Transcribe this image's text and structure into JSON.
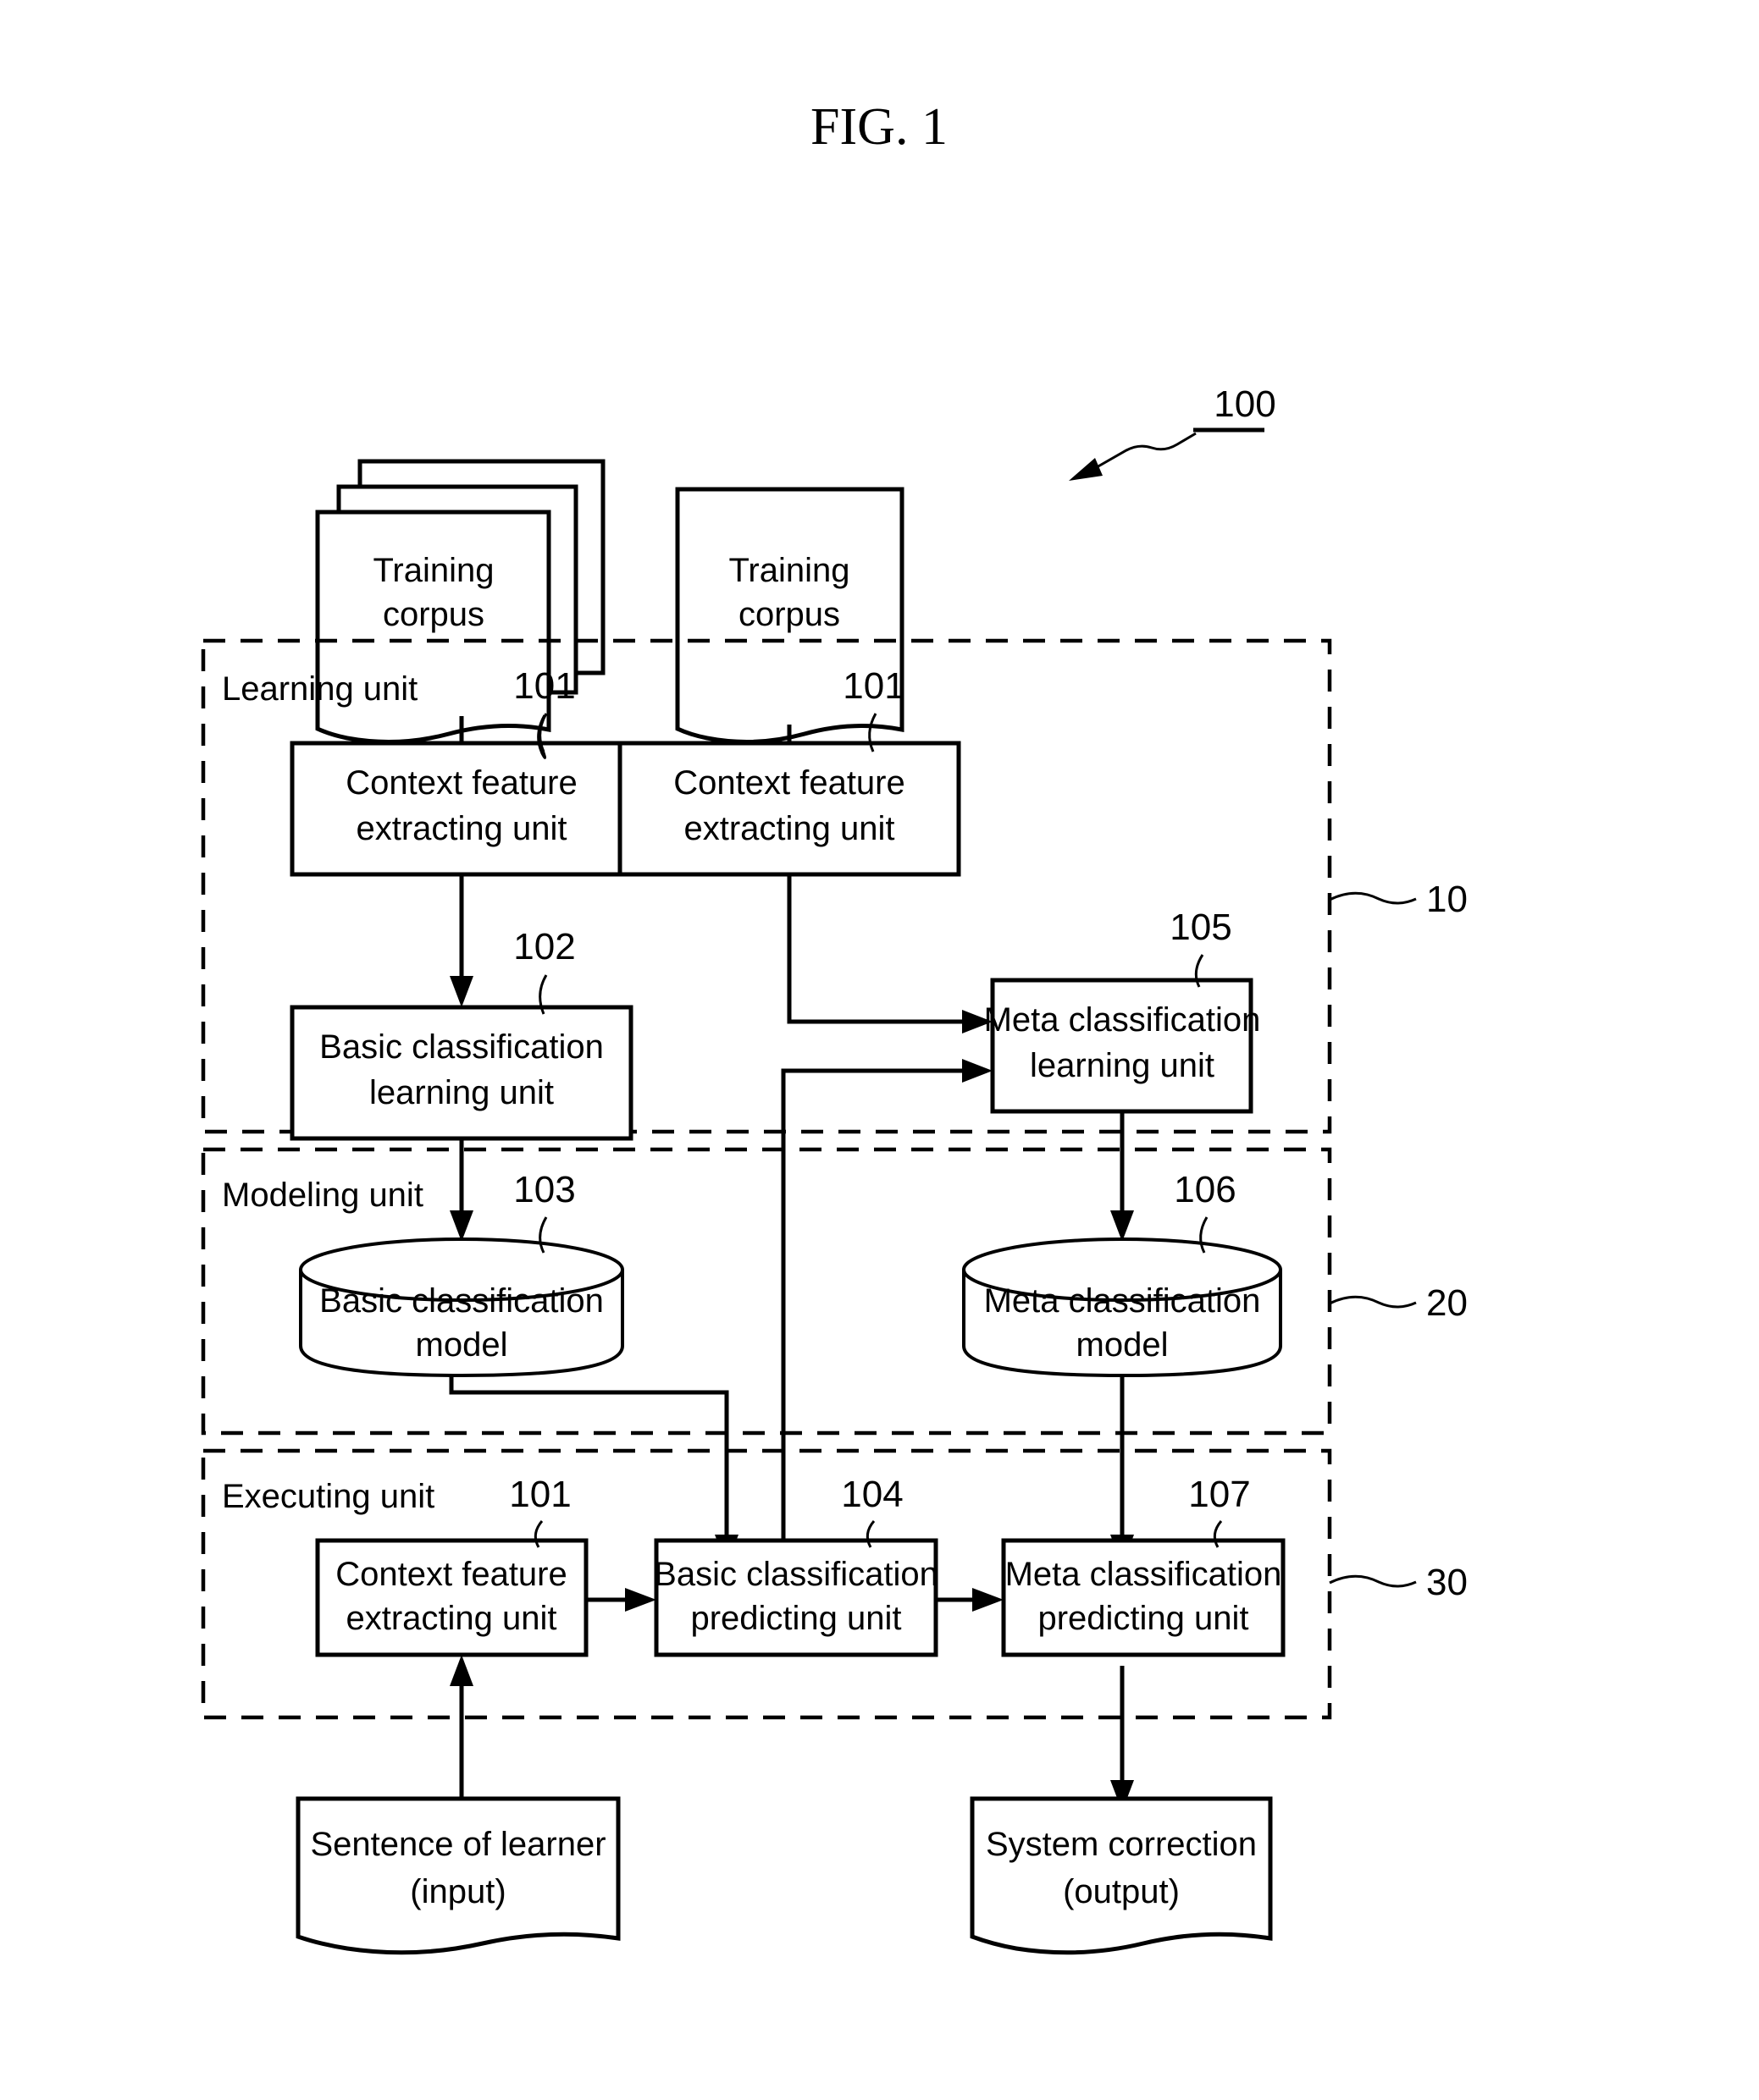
{
  "figure": {
    "title": "FIG. 1",
    "system_ref": "100"
  },
  "sources": [
    {
      "id": "training-corpus-left",
      "lines": [
        "Training",
        "corpus"
      ],
      "shape": "document-stack"
    },
    {
      "id": "training-corpus-right",
      "lines": [
        "Training",
        "corpus"
      ],
      "shape": "document"
    }
  ],
  "groups": [
    {
      "id": "learning-unit",
      "label": "Learning unit",
      "ref": "10"
    },
    {
      "id": "modeling-unit",
      "label": "Modeling unit",
      "ref": "20"
    },
    {
      "id": "executing-unit",
      "label": "Executing unit",
      "ref": "30"
    }
  ],
  "blocks": [
    {
      "id": "context-feature-extracting-unit-learning-left",
      "ref": "101",
      "lines": [
        "Context feature",
        "extracting unit"
      ],
      "group": "learning-unit"
    },
    {
      "id": "context-feature-extracting-unit-learning-right",
      "ref": "101",
      "lines": [
        "Context feature",
        "extracting unit"
      ],
      "group": "learning-unit"
    },
    {
      "id": "basic-classification-learning-unit",
      "ref": "102",
      "lines": [
        "Basic classification",
        "learning unit"
      ],
      "group": "learning-unit"
    },
    {
      "id": "meta-classification-learning-unit",
      "ref": "105",
      "lines": [
        "Meta classification",
        "learning unit"
      ],
      "group": "learning-unit"
    },
    {
      "id": "basic-classification-model",
      "ref": "103",
      "lines": [
        "Basic classification",
        "model"
      ],
      "group": "modeling-unit",
      "shape": "cylinder"
    },
    {
      "id": "meta-classification-model",
      "ref": "106",
      "lines": [
        "Meta classification",
        "model"
      ],
      "group": "modeling-unit",
      "shape": "cylinder"
    },
    {
      "id": "context-feature-extracting-unit-executing",
      "ref": "101",
      "lines": [
        "Context feature",
        "extracting unit"
      ],
      "group": "executing-unit"
    },
    {
      "id": "basic-classification-predicting-unit",
      "ref": "104",
      "lines": [
        "Basic classification",
        "predicting unit"
      ],
      "group": "executing-unit"
    },
    {
      "id": "meta-classification-predicting-unit",
      "ref": "107",
      "lines": [
        "Meta classification",
        "predicting unit"
      ],
      "group": "executing-unit"
    }
  ],
  "terminals": [
    {
      "id": "sentence-of-learner",
      "lines": [
        "Sentence of learner",
        "(input)"
      ],
      "shape": "document"
    },
    {
      "id": "system-correction",
      "lines": [
        "System correction",
        "(output)"
      ],
      "shape": "document"
    }
  ],
  "colors": {
    "stroke": "#000000",
    "background": "#ffffff"
  }
}
